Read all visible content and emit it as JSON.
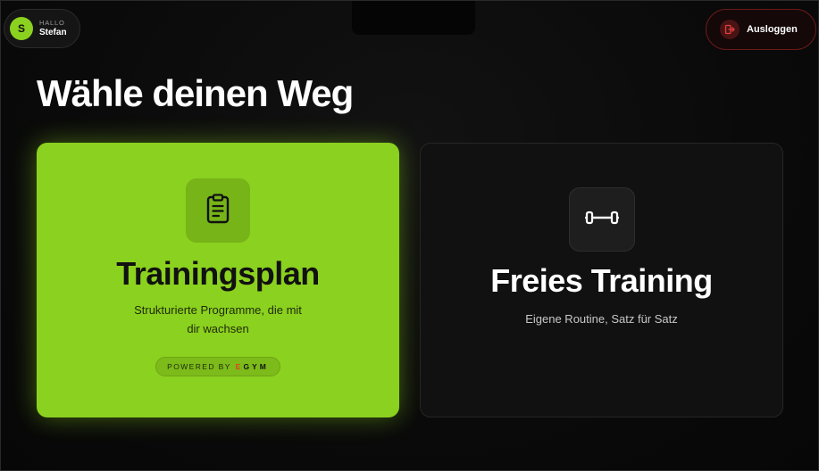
{
  "header": {
    "greeting": "HALLO",
    "user_name": "Stefan",
    "avatar_initial": "S",
    "logout_label": "Ausloggen"
  },
  "main": {
    "title": "Wähle deinen Weg"
  },
  "cards": [
    {
      "title": "Trainingsplan",
      "description": "Strukturierte Programme, die mit dir wachsen",
      "badge_prefix": "POWERED BY",
      "badge_brand_first": "E",
      "badge_brand_rest": "GYM",
      "icon": "clipboard-icon"
    },
    {
      "title": "Freies Training",
      "description": "Eigene Routine, Satz für Satz",
      "icon": "dumbbell-icon"
    }
  ],
  "colors": {
    "accent": "#8bd11f",
    "background": "#0b0b0b",
    "logout_border": "#6b1a1a",
    "brand_e": "#e0401a"
  }
}
